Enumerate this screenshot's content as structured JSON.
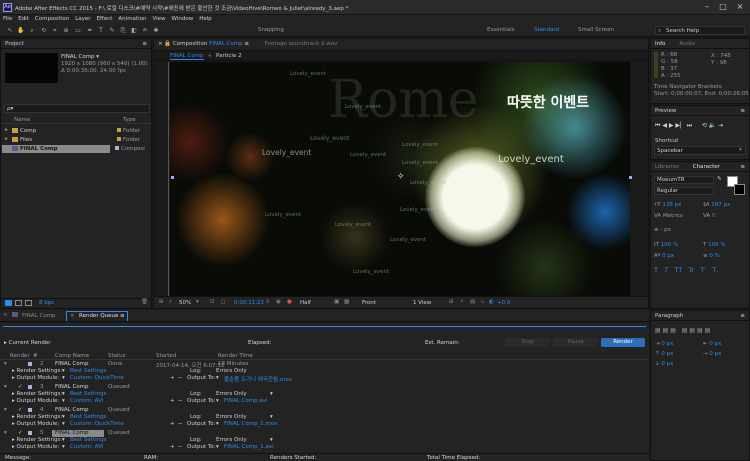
{
  "window": {
    "title": "Adobe After Effects CC 2015 - F:\\ 로컬 디스크\\#예약 시작\\#애진에 받은 불안한 것 조금\\VideoHive\\Romeo & Juliet\\already_3.aep *",
    "app_icon": "Ae"
  },
  "menu": [
    "File",
    "Edit",
    "Composition",
    "Layer",
    "Effect",
    "Animation",
    "View",
    "Window",
    "Help"
  ],
  "toolbar": {
    "snapping": "Snapping",
    "workspaces": [
      "Essentials",
      "Standard",
      "Small Screen"
    ],
    "active_workspace": "Standard",
    "search_placeholder": "Search Help"
  },
  "project": {
    "tab": "Project",
    "selected_name": "FINAL Comp ▾",
    "selected_info": [
      "1920 x 1080  (960 x 540) (1.00)",
      "Δ 0:00:35:00, 24.00 fps"
    ],
    "search_placeholder": "ρ▾",
    "columns": {
      "name": "Name",
      "type": "Type"
    },
    "items": [
      {
        "name": "Comp",
        "type": "Folder"
      },
      {
        "name": "Files",
        "type": "Folder"
      },
      {
        "name": "FINAL Comp",
        "type": "Composi"
      }
    ],
    "bpc": "8 bpc"
  },
  "composition": {
    "tabs": [
      {
        "label": "Composition ",
        "comp": "FINAL Comp",
        "menu": "≡"
      },
      {
        "label": "Footage soundtrack 2.wav"
      }
    ],
    "flow": [
      "FINAL Comp",
      "Particle 2"
    ],
    "title_kr": "따뜻한 이벤트",
    "big_text": "Rome",
    "labels": [
      "Lovely_event",
      "Lovely_event",
      "Lovely_event",
      "Lovely_event",
      "Lovely_event",
      "Lovely_event",
      "Lovely_event",
      "Lovely_event",
      "Lovely_event",
      "Lovely_event",
      "Lovely_event",
      "Lovely_event",
      "Lovely_event",
      "Lovely_event"
    ],
    "footer": {
      "zoom": "50%",
      "timecode": "0:00:11:22",
      "resolution": "Half",
      "view": "Front",
      "views": "1 View",
      "exposure": "+0.0"
    }
  },
  "info": {
    "tabs": [
      "Info",
      "Audio"
    ],
    "color": {
      "r": "R : 68",
      "g": "G : 58",
      "b": "B : 37",
      "a": "A : 255"
    },
    "coords": {
      "x": "X : 748",
      "y": "Y : 98"
    },
    "navigator": "Time Navigator Brackets",
    "range": "Start: 0;00:00:07, End: 0;00:26:05"
  },
  "preview": {
    "tab": "Preview",
    "shortcut_label": "Shortcut",
    "shortcut_value": "Spacebar"
  },
  "character": {
    "tabs": [
      "Libraries",
      "Character"
    ],
    "font": "MoeumTR",
    "style": "Regular",
    "size": "138 px",
    "leading": "187 px",
    "kerning": "Metrics",
    "tracking": "0",
    "stroke": "- px",
    "vscale": "100 %",
    "hscale": "100 %",
    "baseline": "0 px",
    "tsume": "0 %",
    "styles": [
      "T",
      "T",
      "TT",
      "Tr",
      "T'",
      "T,"
    ]
  },
  "paragraph": {
    "tab": "Paragraph",
    "indents": [
      "0 px",
      "0 px",
      "0 px",
      "0 px",
      "0 px"
    ]
  },
  "bottom_tabs": {
    "comp": "FINAL Comp",
    "rq": "Render Queue",
    "rq_menu": "≡"
  },
  "render_queue": {
    "current_render": "Current Render",
    "elapsed": "Elapsed:",
    "est_remain": "Est. Remain:",
    "buttons": {
      "stop": "Stop",
      "pause": "Pause",
      "render": "Render"
    },
    "columns": {
      "render": "Render",
      "label": "#",
      "comp": "Comp Name",
      "status": "Status",
      "started": "Started",
      "render_time": "Render Time"
    },
    "items": [
      {
        "num": "2",
        "comp": "FINAL Comp",
        "status": "Done",
        "started": "2017-04-14, 오전 6:07:52",
        "time": "18 Minutes",
        "settings": "Best Settings",
        "module": "Custom: QuickTime",
        "log": "Errors Only",
        "output": "불순품 오가니 애국한월.mov"
      },
      {
        "num": "3",
        "comp": "FINAL Comp",
        "status": "Queued",
        "started": "",
        "time": "",
        "settings": "Best Settings",
        "module": "Custom: AVI",
        "log": "Errors Only",
        "output": "FINAL Comp.avi"
      },
      {
        "num": "4",
        "comp": "FINAL Comp",
        "status": "Queued",
        "started": "",
        "time": "",
        "settings": "Best Settings",
        "module": "Custom: QuickTime",
        "log": "Errors Only",
        "output": "FINAL Comp_1.mov"
      },
      {
        "num": "5",
        "comp": "FINAL Comp",
        "status": "Queued",
        "started": "",
        "time": "",
        "settings": "Best Settings",
        "module": "Custom: AVI",
        "log": "Errors Only",
        "output": "FINAL Comp_1.avi"
      }
    ],
    "labels": {
      "render_settings": "Render Settings:",
      "output_module": "Output Module:",
      "log": "Log:",
      "output_to": "Output To:"
    },
    "status_bar": {
      "message": "Message:",
      "ram": "RAM:",
      "renders_started": "Renders Started:",
      "total_time": "Total Time Elapsed:"
    }
  }
}
